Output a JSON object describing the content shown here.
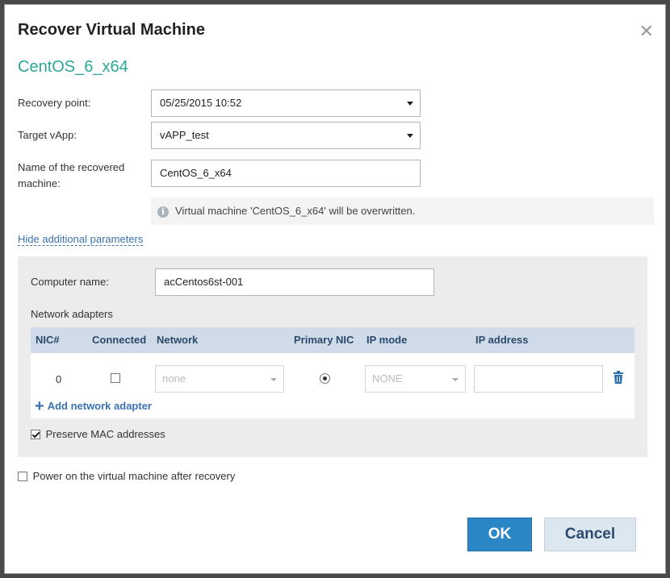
{
  "dialog": {
    "title": "Recover Virtual Machine",
    "vm_name": "CentOS_6_x64"
  },
  "form": {
    "recovery_point_label": "Recovery point:",
    "recovery_point_value": "05/25/2015 10:52",
    "target_vapp_label": "Target vApp:",
    "target_vapp_value": "vAPP_test",
    "recovered_name_label": "Name of the recovered machine:",
    "recovered_name_value": "CentOS_6_x64",
    "info_message": "Virtual machine 'CentOS_6_x64' will be overwritten.",
    "toggle_params_link": "Hide additional parameters"
  },
  "additional": {
    "computer_name_label": "Computer name:",
    "computer_name_value": "acCentos6st-001",
    "network_adapters_label": "Network adapters",
    "columns": [
      "NIC#",
      "Connected",
      "Network",
      "Primary NIC",
      "IP mode",
      "IP address"
    ],
    "rows": [
      {
        "nic": "0",
        "connected": false,
        "network": "none",
        "primary": true,
        "ip_mode": "NONE",
        "ip_address": ""
      }
    ],
    "add_adapter_label": "Add network adapter",
    "preserve_mac_label": "Preserve MAC addresses",
    "preserve_mac_checked": true
  },
  "power_on_label": "Power on the virtual machine after recovery",
  "power_on_checked": false,
  "buttons": {
    "ok": "OK",
    "cancel": "Cancel"
  },
  "colors": {
    "accent_teal": "#2aa79a",
    "primary_button": "#2b86c6",
    "link": "#3b72b3",
    "table_header": "#cfdbe8"
  }
}
